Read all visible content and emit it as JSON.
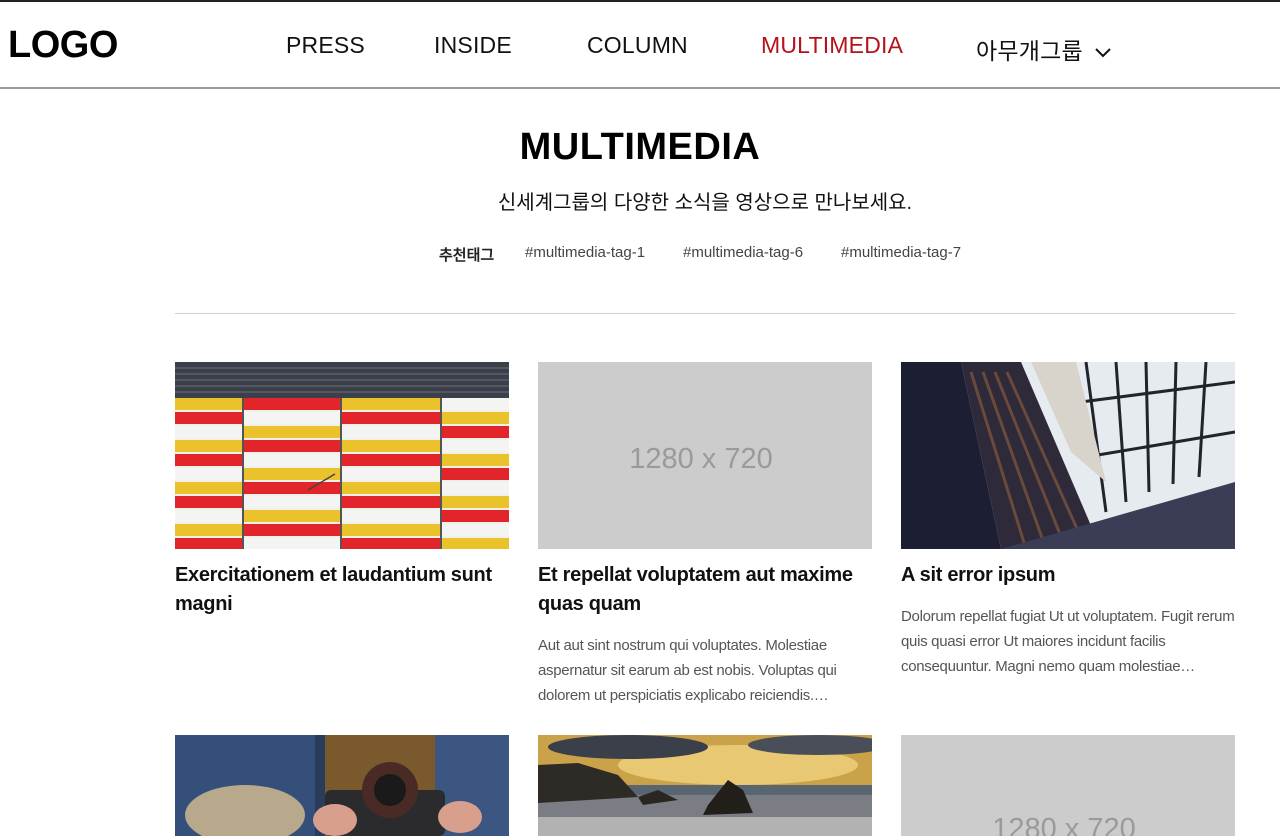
{
  "header": {
    "logo": "LOGO",
    "nav": [
      {
        "label": "PRESS",
        "active": false
      },
      {
        "label": "INSIDE",
        "active": false
      },
      {
        "label": "COLUMN",
        "active": false
      },
      {
        "label": "MULTIMEDIA",
        "active": true
      },
      {
        "label": "아무개그룹",
        "dropdown": true
      }
    ]
  },
  "page": {
    "title": "MULTIMEDIA",
    "subtitle": "신세계그룹의 다양한 소식을 영상으로 만나보세요."
  },
  "tags": {
    "label": "추천태그",
    "items": [
      "#multimedia-tag-1",
      "#multimedia-tag-6",
      "#multimedia-tag-7"
    ]
  },
  "cards": [
    {
      "image": "striped-building-photo",
      "title": "Exercitationem et laudantium sunt magni",
      "desc": ""
    },
    {
      "image": "placeholder",
      "placeholder_text": "1280 x 720",
      "title": "Et repellat voluptatem aut maxime quas quam",
      "desc": "Aut aut sint nostrum qui voluptates. Molestiae aspernatur sit earum ab est nobis. Voluptas qui dolorem ut perspiciatis explicabo reiciendis.…"
    },
    {
      "image": "library-photo",
      "title": "A sit error ipsum",
      "desc": "Dolorum repellat fugiat Ut ut voluptatem. Fugit rerum quis quasi error Ut maiores incidunt facilis consequuntur. Magni nemo quam molestiae…"
    },
    {
      "image": "camera-hands-photo",
      "title": "",
      "desc": ""
    },
    {
      "image": "sea-rocks-photo",
      "title": "",
      "desc": ""
    },
    {
      "image": "placeholder",
      "placeholder_text": "1280 x 720",
      "title": "",
      "desc": ""
    }
  ],
  "colors": {
    "accent": "#b5121b",
    "placeholder_bg": "#cccccc",
    "placeholder_text": "#9a9a9a"
  }
}
